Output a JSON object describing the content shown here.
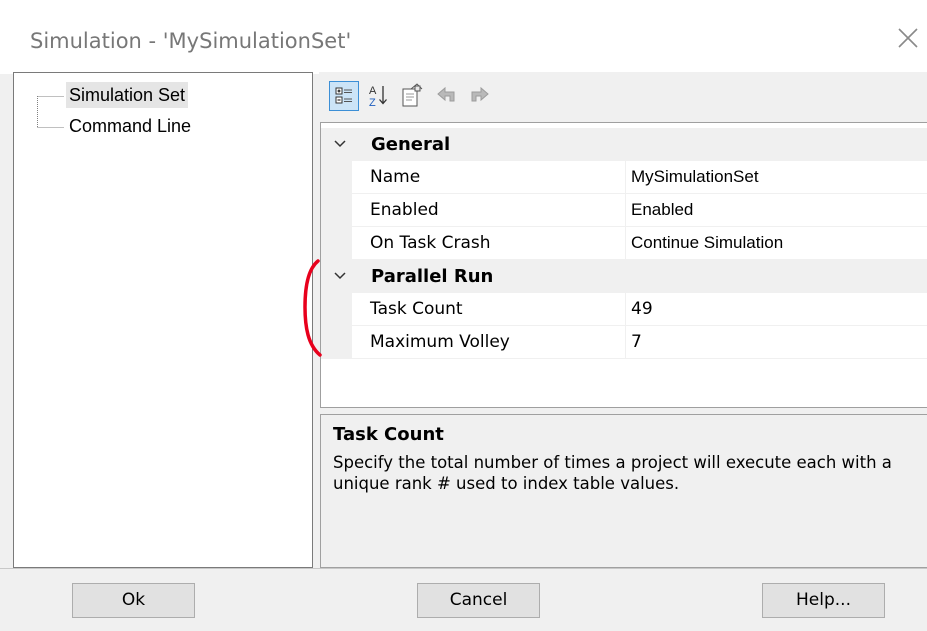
{
  "window": {
    "title": "Simulation - 'MySimulationSet'"
  },
  "tree": {
    "items": [
      {
        "label": "Simulation Set"
      },
      {
        "label": "Command Line"
      }
    ]
  },
  "toolbar": {
    "icons": [
      "categorized-icon",
      "alphabetical-sort-icon",
      "property-pages-icon",
      "back-icon",
      "forward-icon"
    ]
  },
  "grid": {
    "categories": [
      {
        "label": "General",
        "properties": [
          {
            "name": "Name",
            "value": "MySimulationSet"
          },
          {
            "name": "Enabled",
            "value": "Enabled"
          },
          {
            "name": "On Task Crash",
            "value": "Continue Simulation"
          }
        ]
      },
      {
        "label": "Parallel Run",
        "properties": [
          {
            "name": "Task Count",
            "value": "49"
          },
          {
            "name": "Maximum Volley",
            "value": "7"
          }
        ]
      }
    ]
  },
  "description": {
    "title": "Task Count",
    "text": "Specify the total number of times a project will execute each with a unique rank # used to index table values."
  },
  "buttons": {
    "ok": "Ok",
    "cancel": "Cancel",
    "help": "Help..."
  },
  "colors": {
    "annotation": "#e8001c",
    "selection": "#cce4f7"
  }
}
